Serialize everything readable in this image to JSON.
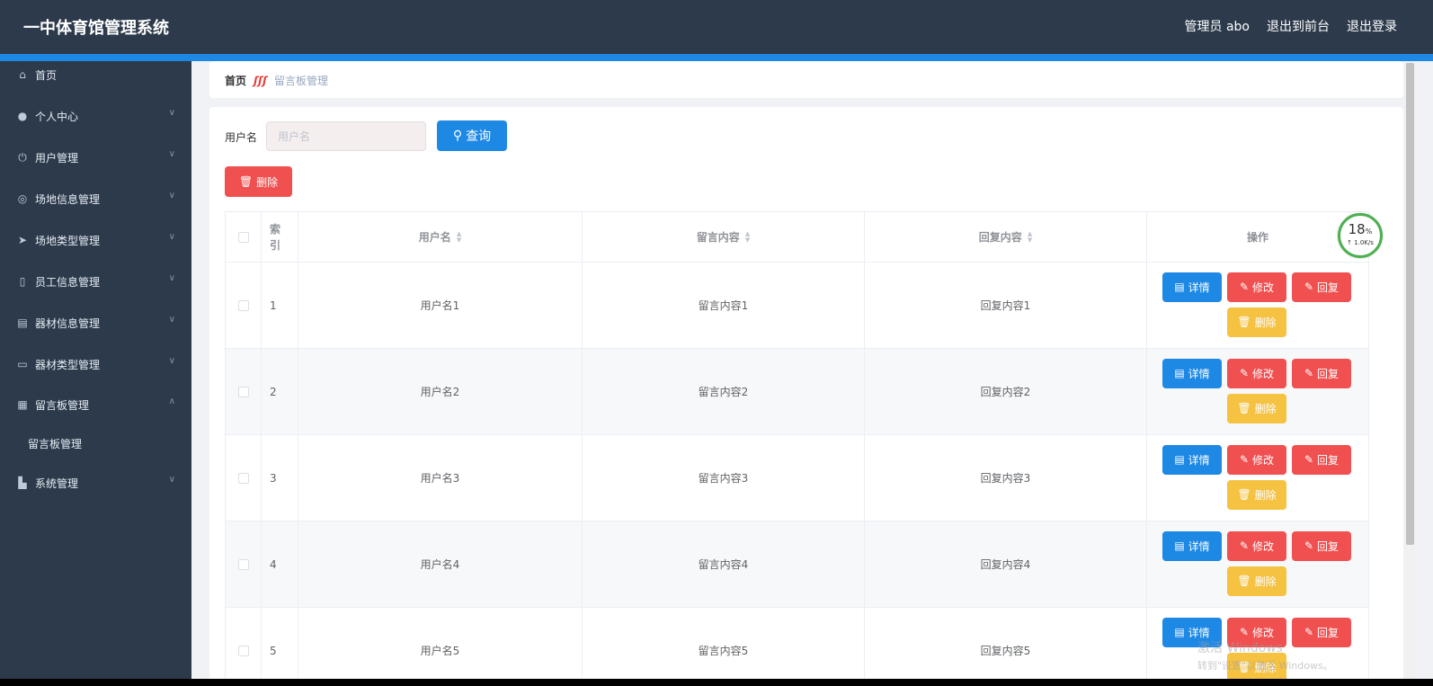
{
  "header": {
    "title": "一中体育馆管理系统",
    "admin_label": "管理员 abo",
    "to_front": "退出到前台",
    "logout": "退出登录"
  },
  "sidebar": {
    "items": [
      {
        "label": "首页",
        "icon": "home-icon"
      },
      {
        "label": "个人中心",
        "icon": "user-icon"
      },
      {
        "label": "用户管理",
        "icon": "power-icon"
      },
      {
        "label": "场地信息管理",
        "icon": "crosshair-icon"
      },
      {
        "label": "场地类型管理",
        "icon": "send-icon"
      },
      {
        "label": "员工信息管理",
        "icon": "microphone-icon"
      },
      {
        "label": "器材信息管理",
        "icon": "document-icon"
      },
      {
        "label": "器材类型管理",
        "icon": "message-icon"
      },
      {
        "label": "留言板管理",
        "icon": "grid-icon"
      },
      {
        "label": "系统管理",
        "icon": "chart-icon"
      }
    ],
    "sub_item": "留言板管理"
  },
  "breadcrumb": {
    "home": "首页",
    "separator": "ʃʃʃ",
    "current": "留言板管理"
  },
  "search": {
    "label": "用户名",
    "placeholder": "用户名",
    "query_button": "查询",
    "delete_button": "删除"
  },
  "table": {
    "headers": {
      "index": "索引",
      "username": "用户名",
      "message": "留言内容",
      "reply": "回复内容",
      "actions": "操作"
    },
    "rows": [
      {
        "index": "1",
        "username": "用户名1",
        "message": "留言内容1",
        "reply": "回复内容1"
      },
      {
        "index": "2",
        "username": "用户名2",
        "message": "留言内容2",
        "reply": "回复内容2"
      },
      {
        "index": "3",
        "username": "用户名3",
        "message": "留言内容3",
        "reply": "回复内容3"
      },
      {
        "index": "4",
        "username": "用户名4",
        "message": "留言内容4",
        "reply": "回复内容4"
      },
      {
        "index": "5",
        "username": "用户名5",
        "message": "留言内容5",
        "reply": "回复内容5"
      }
    ],
    "action_labels": {
      "detail": "详情",
      "edit": "修改",
      "reply": "回复",
      "delete": "删除"
    }
  },
  "speed_widget": {
    "percent": "18",
    "percent_unit": "%",
    "rate": "↑ 1.0K/s"
  },
  "watermark": {
    "line1": "激活 Windows",
    "line2": "转到\"设置\"以激活 Windows。"
  },
  "colors": {
    "header_bg": "#2d3a4b",
    "accent_blue": "#1e88e5",
    "danger_red": "#f05050",
    "warning_yellow": "#f5c242"
  }
}
